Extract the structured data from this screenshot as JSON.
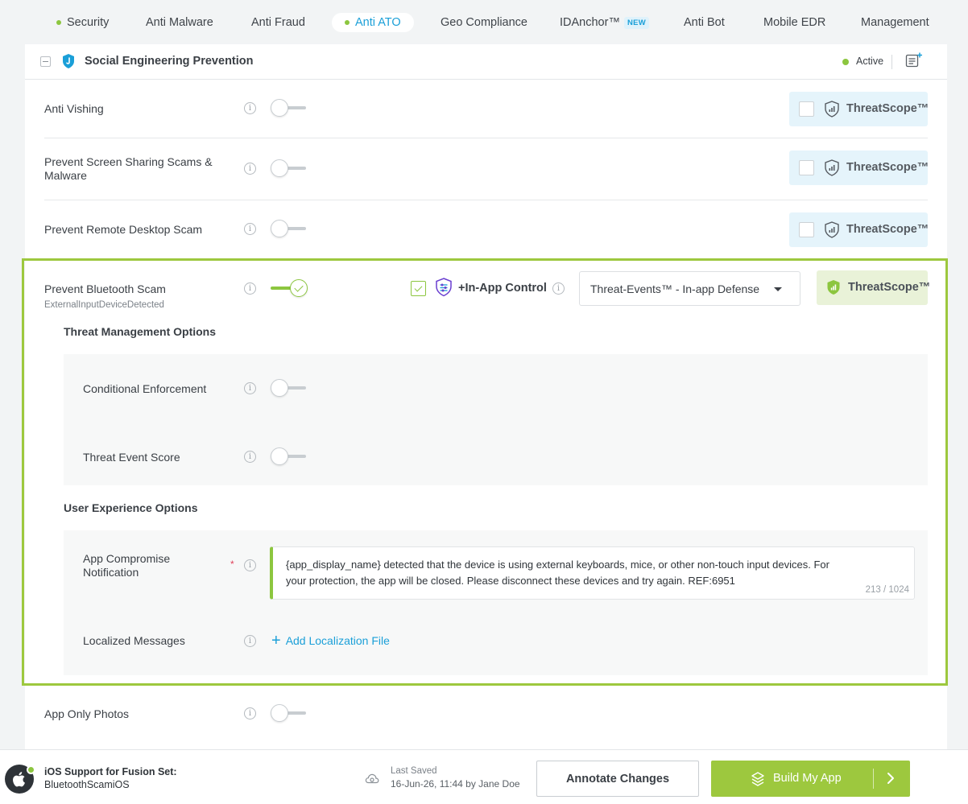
{
  "tabs": [
    {
      "label": "Security",
      "dot": true
    },
    {
      "label": "Anti Malware"
    },
    {
      "label": "Anti Fraud"
    },
    {
      "label": "Anti ATO",
      "dot": true,
      "active": true
    },
    {
      "label": "Geo Compliance"
    },
    {
      "label": "IDAnchor™",
      "badge": "NEW"
    },
    {
      "label": "Anti Bot"
    },
    {
      "label": "Mobile EDR"
    },
    {
      "label": "Management"
    }
  ],
  "panel": {
    "title": "Social Engineering Prevention",
    "status": "Active"
  },
  "rows": {
    "anti_vishing": {
      "label": "Anti Vishing",
      "threatscope": "ThreatScope™"
    },
    "screen_sharing": {
      "label": "Prevent Screen Sharing Scams & Malware",
      "threatscope": "ThreatScope™"
    },
    "remote_desktop": {
      "label": "Prevent Remote Desktop Scam",
      "threatscope": "ThreatScope™"
    },
    "bluetooth": {
      "label": "Prevent Bluetooth Scam",
      "sublabel": "ExternalInputDeviceDetected",
      "inapp_label": "+In-App Control",
      "select_value": "Threat-Events™ - In-app Defense",
      "threatscope": "ThreatScope™"
    },
    "app_only_photos": {
      "label": "App Only Photos"
    }
  },
  "threat_mgmt": {
    "title": "Threat Management Options",
    "conditional": "Conditional Enforcement",
    "score": "Threat Event Score"
  },
  "ux": {
    "title": "User Experience Options",
    "notification_label": "App Compromise Notification",
    "required_mark": "*",
    "notification_text": "{app_display_name} detected that the device is using external keyboards, mice, or other non-touch input devices. For your protection, the app will be closed. Please disconnect these devices and try again. REF:6951",
    "char_count": "213 / 1024",
    "localized_label": "Localized Messages",
    "add_localization": "Add Localization File"
  },
  "footer": {
    "os_title": "iOS Support for Fusion Set:",
    "os_sub": "BluetoothScamiOS",
    "saved_label": "Last Saved",
    "saved_time": "16-Jun-26, 11:44 by Jane Doe",
    "annotate": "Annotate Changes",
    "build": "Build My App"
  },
  "colors": {
    "accent_blue": "#1a9fd8",
    "accent_green": "#8cc63f",
    "build_green": "#9dc83e"
  }
}
